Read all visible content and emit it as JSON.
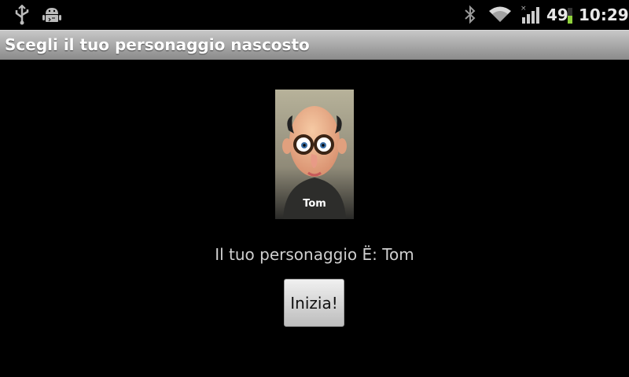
{
  "status_bar": {
    "icons": [
      "usb-icon",
      "android-debug-icon",
      "bluetooth-icon",
      "wifi-icon",
      "signal-icon",
      "battery-icon"
    ],
    "battery_percent": "49",
    "battery_level": 0.49,
    "time": "10:29"
  },
  "title_bar": {
    "title": "Scegli il tuo personaggio nascosto"
  },
  "main": {
    "portrait_name": "Tom",
    "message": "Il tuo personaggio Ë: Tom",
    "start_button_label": "Inizia!"
  },
  "colors": {
    "background": "#000000",
    "title_bar": "#a8a8a8",
    "battery_accent": "#8fd13c",
    "message_text": "#cfcfcf"
  }
}
